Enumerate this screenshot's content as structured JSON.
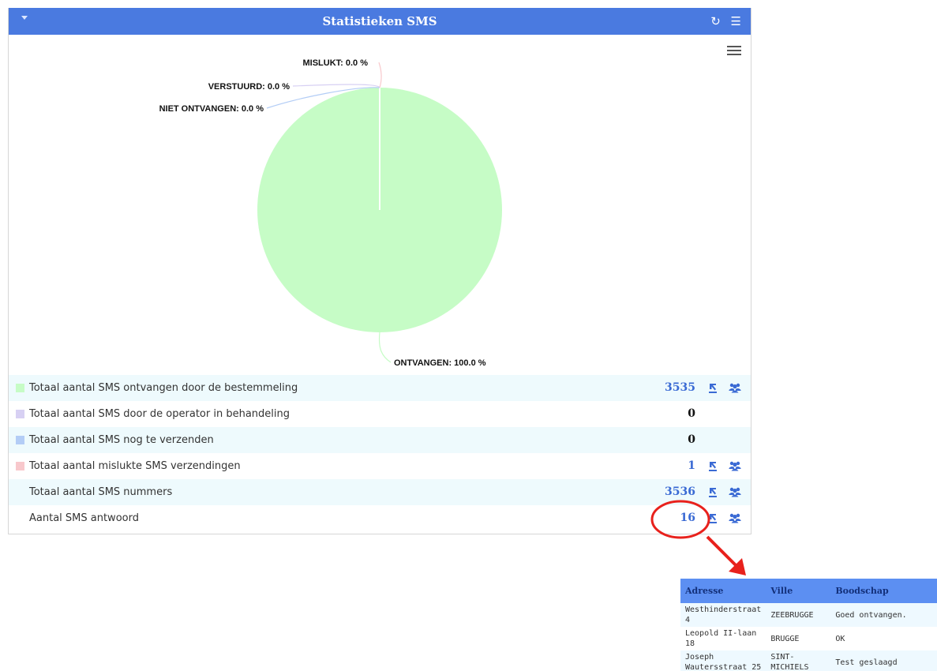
{
  "panel": {
    "title": "Statistieken SMS",
    "refresh_icon": "refresh-icon",
    "list_icon": "list-icon",
    "collapse_icon": "caret-down-icon"
  },
  "chart_data": {
    "type": "pie",
    "categories": [
      "ONTVANGEN",
      "VERSTUURD",
      "NIET ONTVANGEN",
      "MISLUKT"
    ],
    "values": [
      100.0,
      0.0,
      0.0,
      0.0
    ],
    "labels": [
      "ONTVANGEN: 100.0 %",
      "VERSTUURD: 0.0 %",
      "NIET ONTVANGEN: 0.0 %",
      "MISLUKT: 0.0 %"
    ],
    "colors": [
      "#c6fcc6",
      "#d7d0f3",
      "#b3cdf6",
      "#f8c8cc"
    ],
    "title": "",
    "legend": "none"
  },
  "stats": {
    "rows": [
      {
        "label": "Totaal aantal SMS ontvangen door de bestemmeling",
        "value": "3535",
        "color": "#c6fcc6",
        "has_actions": true
      },
      {
        "label": "Totaal aantal SMS door de operator in behandeling",
        "value": "0",
        "color": "#d7d0f3",
        "has_actions": false
      },
      {
        "label": "Totaal aantal SMS nog te verzenden",
        "value": "0",
        "color": "#b3cdf6",
        "has_actions": false
      },
      {
        "label": "Totaal aantal mislukte SMS verzendingen",
        "value": "1",
        "color": "#f8c8cc",
        "has_actions": true
      },
      {
        "label": "Totaal aantal SMS nummers",
        "value": "3536",
        "color": "",
        "has_actions": true
      },
      {
        "label": "Aantal SMS antwoord",
        "value": "16",
        "color": "",
        "has_actions": true
      }
    ],
    "export_icon": "export-icon",
    "users_icon": "users-icon"
  },
  "popup": {
    "headers": [
      "Adresse",
      "Ville",
      "Boodschap"
    ],
    "rows": [
      [
        "Westhinderstraat 4",
        "ZEEBRUGGE",
        "Goed ontvangen."
      ],
      [
        "Leopold II-laan 18",
        "BRUGGE",
        "OK"
      ],
      [
        "Joseph Wautersstraat 25",
        "SINT-MICHIELS",
        "Test geslaagd"
      ]
    ]
  },
  "accent": "#4a7ae0",
  "annotation_color": "#e8211c"
}
